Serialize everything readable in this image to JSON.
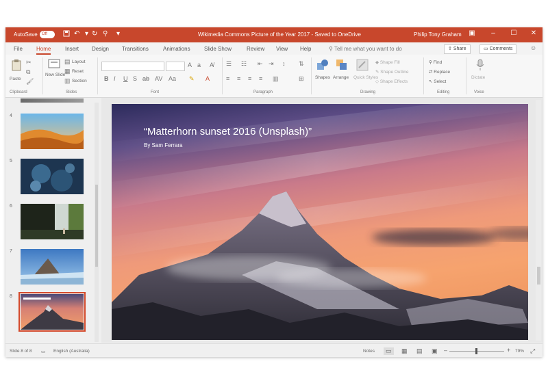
{
  "titlebar": {
    "autosave": "AutoSave",
    "autosave_state": "Off",
    "title": "Wikimedia Commons Picture of the Year 2017 - Saved to OneDrive",
    "user": "Philip Tony Graham",
    "icons": [
      "save-icon",
      "undo-icon",
      "redo-icon",
      "presenter-icon",
      "customize-qat-icon"
    ]
  },
  "tabs": [
    "File",
    "Home",
    "Insert",
    "Design",
    "Transitions",
    "Animations",
    "Slide Show",
    "Review",
    "View",
    "Help"
  ],
  "active_tab": "Home",
  "tell_me": "Tell me what you want to do",
  "share_label": "Share",
  "comments_label": "Comments",
  "ribbon": {
    "groups": [
      "Clipboard",
      "Slides",
      "Font",
      "Paragraph",
      "Drawing",
      "Editing",
      "Voice"
    ],
    "paste": "Paste",
    "new_slide": "New Slide",
    "layout": "Layout",
    "reset": "Reset",
    "section": "Section",
    "shapes": "Shapes",
    "arrange": "Arrange",
    "quick_styles": "Quick Styles",
    "shape_fill": "Shape Fill",
    "shape_outline": "Shape Outline",
    "shape_effects": "Shape Effects",
    "find": "Find",
    "replace": "Replace",
    "select": "Select",
    "dictate": "Dictate"
  },
  "thumbnails": [
    {
      "num": "4",
      "theme": "desert"
    },
    {
      "num": "5",
      "theme": "ice"
    },
    {
      "num": "6",
      "theme": "waterfall"
    },
    {
      "num": "7",
      "theme": "glacier"
    },
    {
      "num": "8",
      "theme": "matterhorn",
      "selected": true
    }
  ],
  "slide": {
    "title": "“Matterhorn sunset 2016 (Unsplash)”",
    "subtitle": "By Sam Ferrara"
  },
  "status": {
    "slide_of": "Slide 8 of 8",
    "language": "English (Australia)",
    "notes": "Notes",
    "zoom": "79%"
  },
  "colors": {
    "accent": "#c8472c",
    "selected_outline": "#d34a2c"
  }
}
